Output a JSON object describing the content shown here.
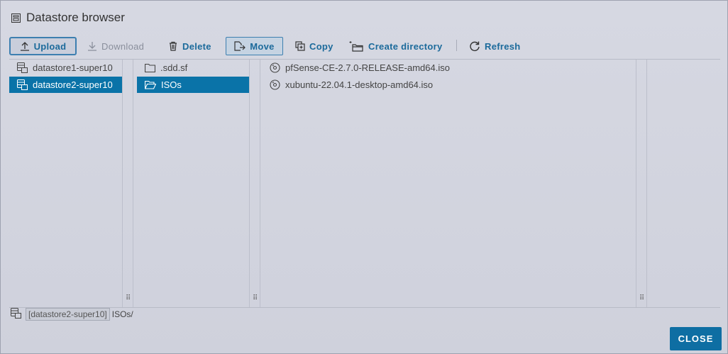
{
  "dialog": {
    "title": "Datastore browser",
    "title_icon": "datastore-browser-icon"
  },
  "toolbar": {
    "upload": "Upload",
    "download": "Download",
    "delete": "Delete",
    "move": "Move",
    "copy": "Copy",
    "create_directory": "Create directory",
    "refresh": "Refresh"
  },
  "datastores": [
    {
      "label": "datastore1-super10",
      "selected": false,
      "icon": "datastore-icon"
    },
    {
      "label": "datastore2-super10",
      "selected": true,
      "icon": "datastore-icon"
    }
  ],
  "folders": [
    {
      "label": ".sdd.sf",
      "selected": false,
      "icon": "folder-icon"
    },
    {
      "label": "ISOs",
      "selected": true,
      "icon": "folder-open-icon"
    }
  ],
  "files": [
    {
      "label": "pfSense-CE-2.7.0-RELEASE-amd64.iso",
      "icon": "disc-icon"
    },
    {
      "label": "xubuntu-22.04.1-desktop-amd64.iso",
      "icon": "disc-icon"
    }
  ],
  "path": {
    "datastore": "[datastore2-super10]",
    "folder": "ISOs/"
  },
  "footer": {
    "close": "CLOSE"
  },
  "colors": {
    "accent": "#0a73a8",
    "link": "#1b6a9b"
  }
}
